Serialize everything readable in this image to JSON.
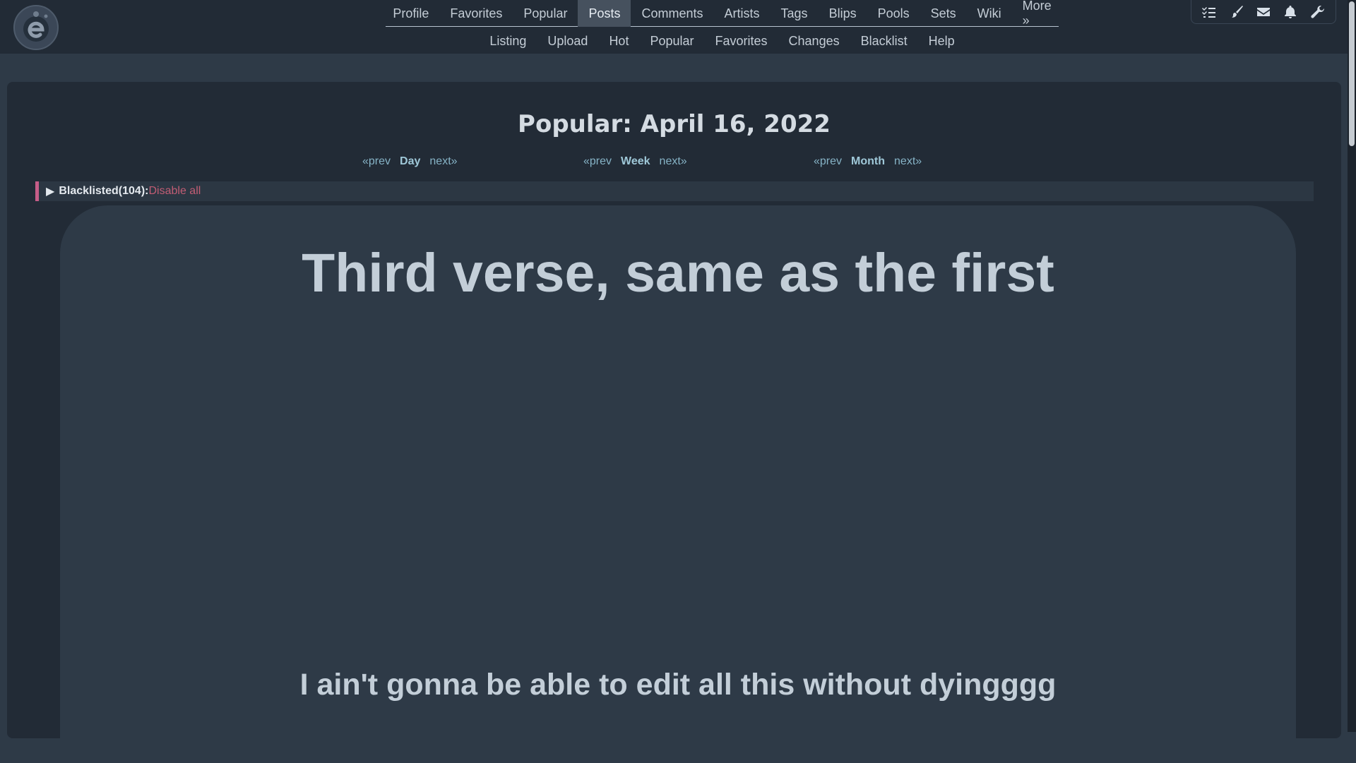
{
  "header": {
    "logo_icon": "e621-logo-icon",
    "primary_nav": [
      {
        "label": "Profile"
      },
      {
        "label": "Favorites"
      },
      {
        "label": "Popular"
      },
      {
        "label": "Posts",
        "active": true
      },
      {
        "label": "Comments"
      },
      {
        "label": "Artists"
      },
      {
        "label": "Tags"
      },
      {
        "label": "Blips"
      },
      {
        "label": "Pools"
      },
      {
        "label": "Sets"
      },
      {
        "label": "Wiki"
      },
      {
        "label": "More »"
      }
    ],
    "secondary_nav": [
      {
        "label": "Listing"
      },
      {
        "label": "Upload"
      },
      {
        "label": "Hot"
      },
      {
        "label": "Popular"
      },
      {
        "label": "Favorites"
      },
      {
        "label": "Changes"
      },
      {
        "label": "Blacklist"
      },
      {
        "label": "Help"
      }
    ],
    "toolbar_icons": [
      "list-check-icon",
      "brush-icon",
      "envelope-icon",
      "bell-icon",
      "wrench-icon"
    ]
  },
  "page": {
    "title": "Popular: April 16, 2022",
    "periods": {
      "day": {
        "prev": "«prev",
        "label": "Day",
        "next": "next»"
      },
      "week": {
        "prev": "«prev",
        "label": "Week",
        "next": "next»"
      },
      "month": {
        "prev": "«prev",
        "label": "Month",
        "next": "next»"
      }
    },
    "blacklist": {
      "arrow": "▶",
      "label": "Blacklisted(104):",
      "disable": "Disable all"
    }
  },
  "post": {
    "heading": "Third verse, same as the first",
    "subtext": "I ain't gonna be able to edit all this without dyingggg"
  },
  "colors": {
    "accent_pink": "#c65d88",
    "link_blue": "#86b3c6",
    "disable_red": "#c25d74"
  }
}
